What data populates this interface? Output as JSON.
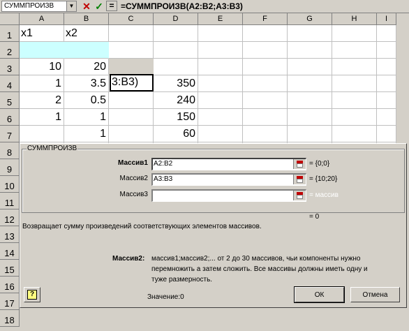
{
  "formula_bar": {
    "name_box": "СУММПРОИЗВ",
    "name_box_arrow": "▼",
    "cancel_icon": "✕",
    "enter_icon": "✓",
    "equal_label": "=",
    "formula": "=СУММПРОИЗВ(A2:B2;A3:B3)"
  },
  "grid": {
    "columns": [
      "A",
      "B",
      "C",
      "D",
      "E",
      "F",
      "G",
      "H",
      "I"
    ],
    "rows": [
      "1",
      "2",
      "3",
      "4",
      "5",
      "6",
      "7",
      "8",
      "9",
      "10",
      "11",
      "12",
      "13",
      "14",
      "15",
      "16",
      "17",
      "18"
    ],
    "cells": {
      "A1": "x1",
      "B1": "x2",
      "A3": "10",
      "B3": "20",
      "C3": "3:B3)",
      "A4": "1",
      "B4": "3.5",
      "D4": "350",
      "A5": "2",
      "B5": "0.5",
      "D5": "240",
      "A6": "1",
      "B6": "1",
      "D6": "150",
      "B7": "1",
      "D7": "60"
    },
    "highlight_color": "#ccffff"
  },
  "dialog": {
    "function_name": "СУММПРОИЗВ",
    "args": [
      {
        "label": "Массив1",
        "value": "A2:B2",
        "result": "= {0;0}"
      },
      {
        "label": "Массив2",
        "value": "A3:B3",
        "result": "= {10;20}"
      },
      {
        "label": "Массив3",
        "value": "",
        "result": "= массив"
      }
    ],
    "total_result": "= 0",
    "description": "Возвращает сумму произведений соответствующих элементов массивов.",
    "arg_help_label": "Массив2:",
    "arg_help_line1": "массив1;массив2;... от 2 до 30 массивов, чьи компоненты нужно",
    "arg_help_line2": "перемножить а затем сложить. Все массивы должны иметь одну и",
    "arg_help_line3": "туже размерность.",
    "value_label": "Значение:",
    "value": "0",
    "help_icon": "?",
    "ok_label": "ОК",
    "cancel_label": "Отмена"
  }
}
